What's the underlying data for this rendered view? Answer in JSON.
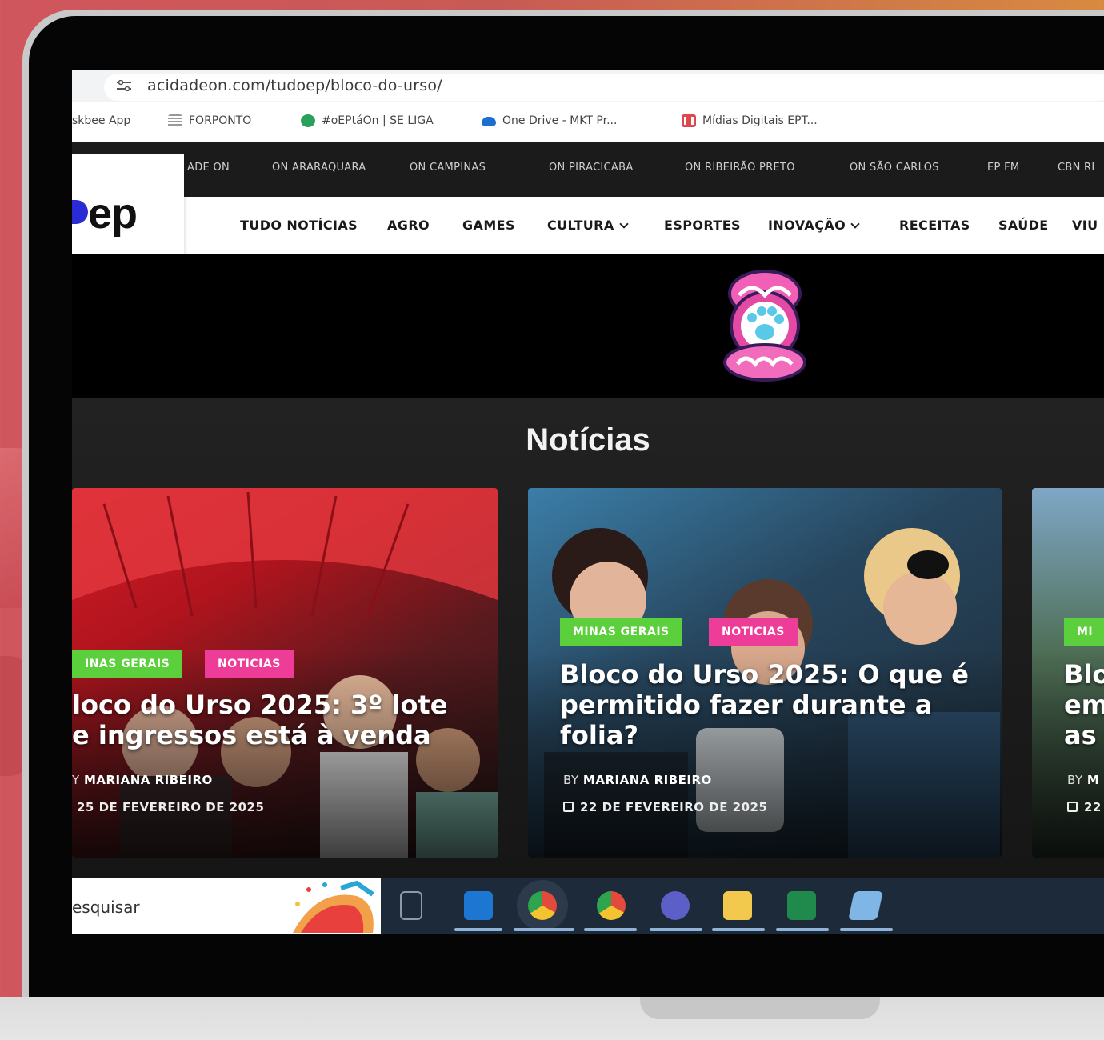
{
  "browser": {
    "url": "acidadeon.com/tudoep/bloco-do-urso/",
    "bookmarks": [
      {
        "label": "skbee App",
        "icon": "app-icon"
      },
      {
        "label": "FORPONTO",
        "icon": "list-icon"
      },
      {
        "label": "#oEPtáOn | SE LIGA",
        "icon": "teams-icon"
      },
      {
        "label": "One Drive - MKT Pr...",
        "icon": "cloud-icon"
      },
      {
        "label": "Mídias Digitais EPT...",
        "icon": "trello-icon"
      }
    ]
  },
  "site": {
    "logo": "ep",
    "top_nav": [
      "ADE ON",
      "ON ARARAQUARA",
      "ON CAMPINAS",
      "ON PIRACICABA",
      "ON RIBEIRÃO PRETO",
      "ON SÃO CARLOS",
      "EP FM",
      "CBN RI"
    ],
    "main_nav": [
      "TUDO NOTÍCIAS",
      "AGRO",
      "GAMES",
      "CULTURA",
      "ESPORTES",
      "INOVAÇÃO",
      "RECEITAS",
      "SAÚDE",
      "VIU"
    ],
    "section_title": "Notícias",
    "cards": [
      {
        "tags": [
          "INAS GERAIS",
          "NOTICIAS"
        ],
        "title": "loco do Urso 2025: 3º lote e ingressos está à venda",
        "by_prefix": "Y",
        "author": "MARIANA RIBEIRO",
        "date": "25 DE FEVEREIRO DE 2025"
      },
      {
        "tags": [
          "MINAS GERAIS",
          "NOTICIAS"
        ],
        "title": "Bloco do Urso 2025: O que é permitido fazer durante a folia?",
        "by_prefix": "BY",
        "author": "MARIANA RIBEIRO",
        "date": "22 DE FEVEREIRO DE 2025"
      },
      {
        "tags": [
          "MI"
        ],
        "title": "Blo em as",
        "by_prefix": "BY",
        "author": "M",
        "date": "22"
      }
    ]
  },
  "taskbar": {
    "search_placeholder": "esquisar"
  },
  "colors": {
    "tag_green": "#5ccf3c",
    "tag_pink": "#ee3d98",
    "logo_blue": "#2b2bd6"
  }
}
